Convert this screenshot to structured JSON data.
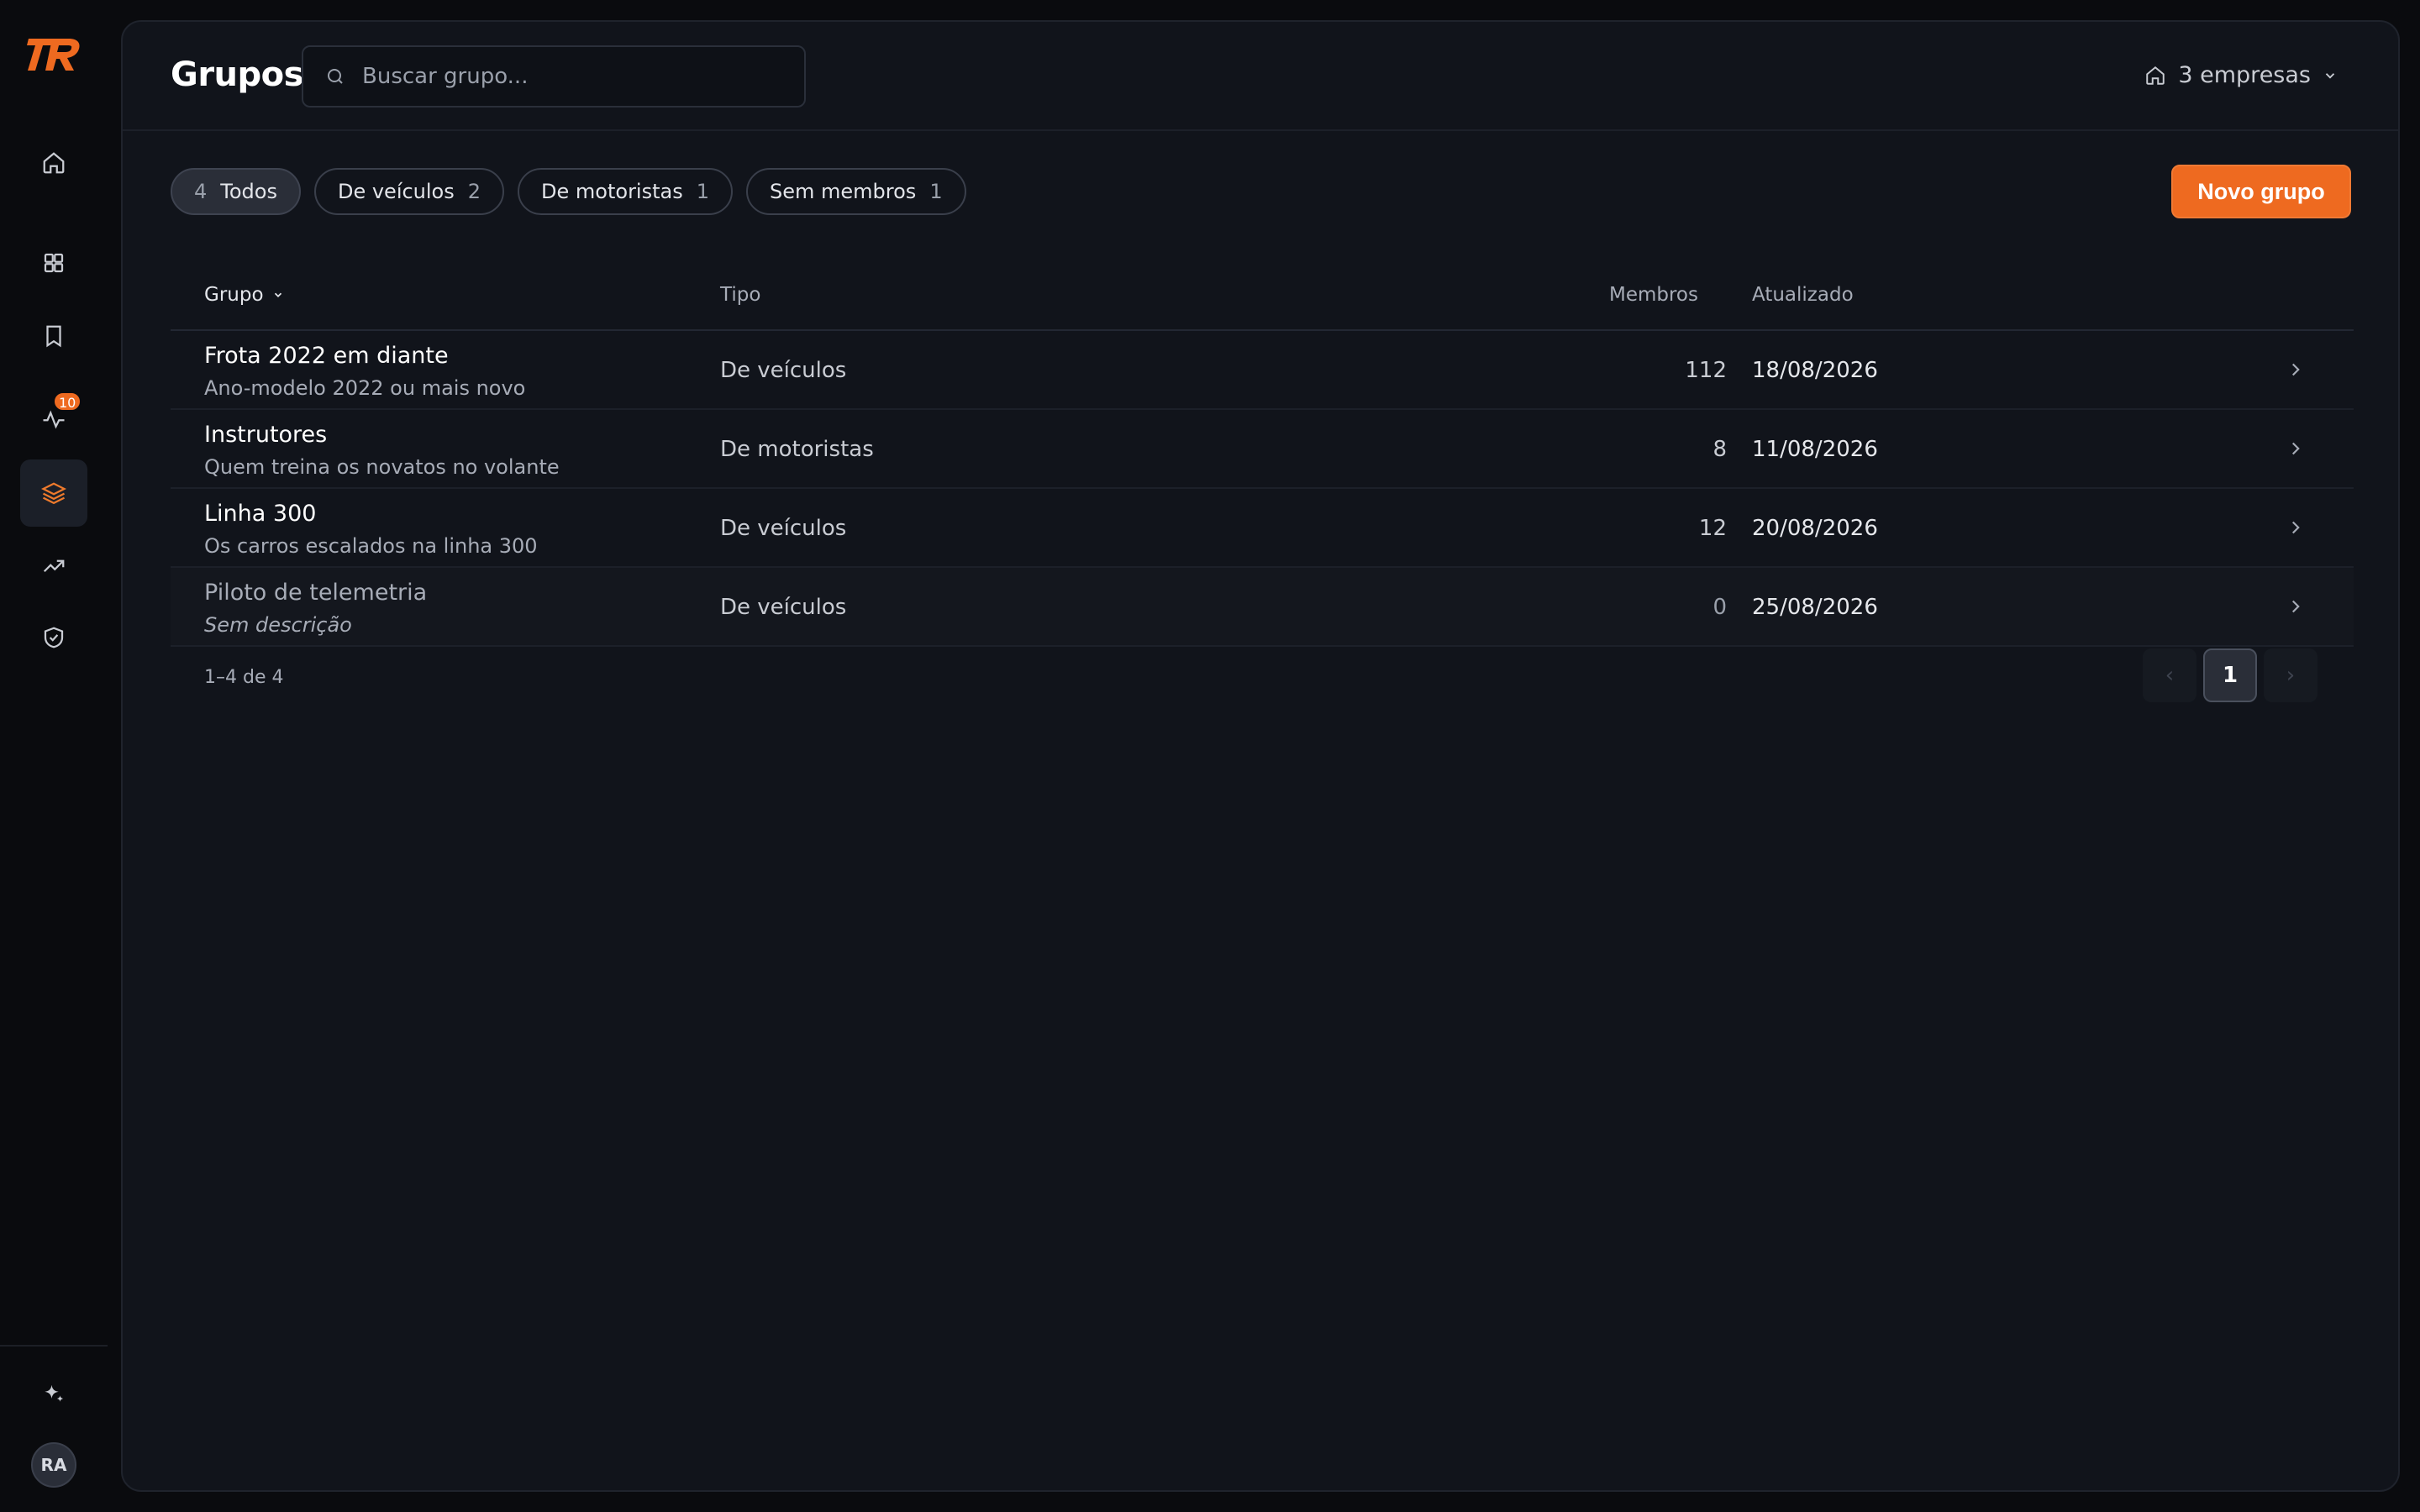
{
  "app": {
    "logo_text": "TR",
    "brand_color": "#ee6a20"
  },
  "sidebar": {
    "items": [
      {
        "icon": "home-icon"
      },
      {
        "icon": "grid-icon"
      },
      {
        "icon": "bookmark-icon"
      },
      {
        "icon": "activity-icon",
        "badge": "10"
      },
      {
        "icon": "layers-icon",
        "active": true
      },
      {
        "icon": "trending-up-icon"
      },
      {
        "icon": "shield-check-icon"
      }
    ],
    "bottom": {
      "sparkle_icon": "sparkle-icon",
      "avatar": "RA"
    }
  },
  "header": {
    "title": "Grupos",
    "search_placeholder": "Buscar grupo...",
    "company_selector": "3 empresas"
  },
  "filters": [
    {
      "label": "Todos",
      "count": "4",
      "active": true
    },
    {
      "label": "De veículos",
      "count": "2"
    },
    {
      "label": "De motoristas",
      "count": "1"
    },
    {
      "label": "Sem membros",
      "count": "1"
    }
  ],
  "actions": {
    "new_group": "Novo grupo"
  },
  "table": {
    "columns": {
      "grupo": "Grupo",
      "tipo": "Tipo",
      "membros": "Membros",
      "atualizado": "Atualizado"
    },
    "rows": [
      {
        "name": "Frota 2022 em diante",
        "desc": "Ano-modelo 2022 ou mais novo",
        "tipo": "De veículos",
        "membros": "112",
        "atualizado": "18/08/2026"
      },
      {
        "name": "Instrutores",
        "desc": "Quem treina os novatos no volante",
        "tipo": "De motoristas",
        "membros": "8",
        "atualizado": "11/08/2026"
      },
      {
        "name": "Linha 300",
        "desc": "Os carros escalados na linha 300",
        "tipo": "De veículos",
        "membros": "12",
        "atualizado": "20/08/2026"
      },
      {
        "name": "Piloto de telemetria",
        "desc": "Sem descrição",
        "tipo": "De veículos",
        "membros": "0",
        "atualizado": "25/08/2026"
      }
    ]
  },
  "pagination": {
    "info": "1–4 de 4",
    "current": "1",
    "prev": "‹",
    "next": "›"
  }
}
